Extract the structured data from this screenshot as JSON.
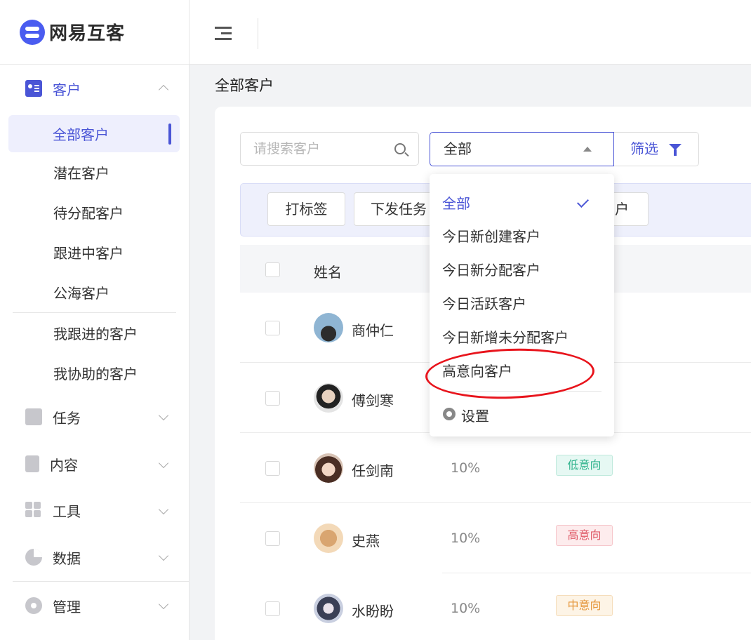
{
  "brand": {
    "name": "网易互客"
  },
  "sidebar": {
    "customer_group": "客户",
    "customer_items": [
      "全部客户",
      "潜在客户",
      "待分配客户",
      "跟进中客户",
      "公海客户"
    ],
    "my_items": [
      "我跟进的客户",
      "我协助的客户"
    ],
    "groups": [
      "任务",
      "内容",
      "工具",
      "数据"
    ],
    "manage": "管理"
  },
  "page": {
    "title": "全部客户"
  },
  "search": {
    "placeholder": "请搜索客户"
  },
  "select": {
    "value": "全部"
  },
  "filter": {
    "label": "筛选"
  },
  "batch": {
    "tag_label": "打标签",
    "task_label": "下发任务",
    "partial_label": "户"
  },
  "table": {
    "header_name": "姓名",
    "rows": [
      {
        "name": "商仲仁",
        "rate": "",
        "tag": ""
      },
      {
        "name": "傅剑寒",
        "rate": "",
        "tag": ""
      },
      {
        "name": "任剑南",
        "rate": "10%",
        "tag": "低意向"
      },
      {
        "name": "史燕",
        "rate": "10%",
        "tag": "高意向"
      },
      {
        "name": "水盼盼",
        "rate": "10%",
        "tag": "中意向"
      }
    ]
  },
  "dropdown": {
    "options": [
      "全部",
      "今日新创建客户",
      "今日新分配客户",
      "今日活跃客户",
      "今日新增未分配客户",
      "高意向客户"
    ],
    "selected_index": 0,
    "settings_label": "设置"
  },
  "colors": {
    "accent": "#4a55d6",
    "annotation": "#e8141c"
  }
}
